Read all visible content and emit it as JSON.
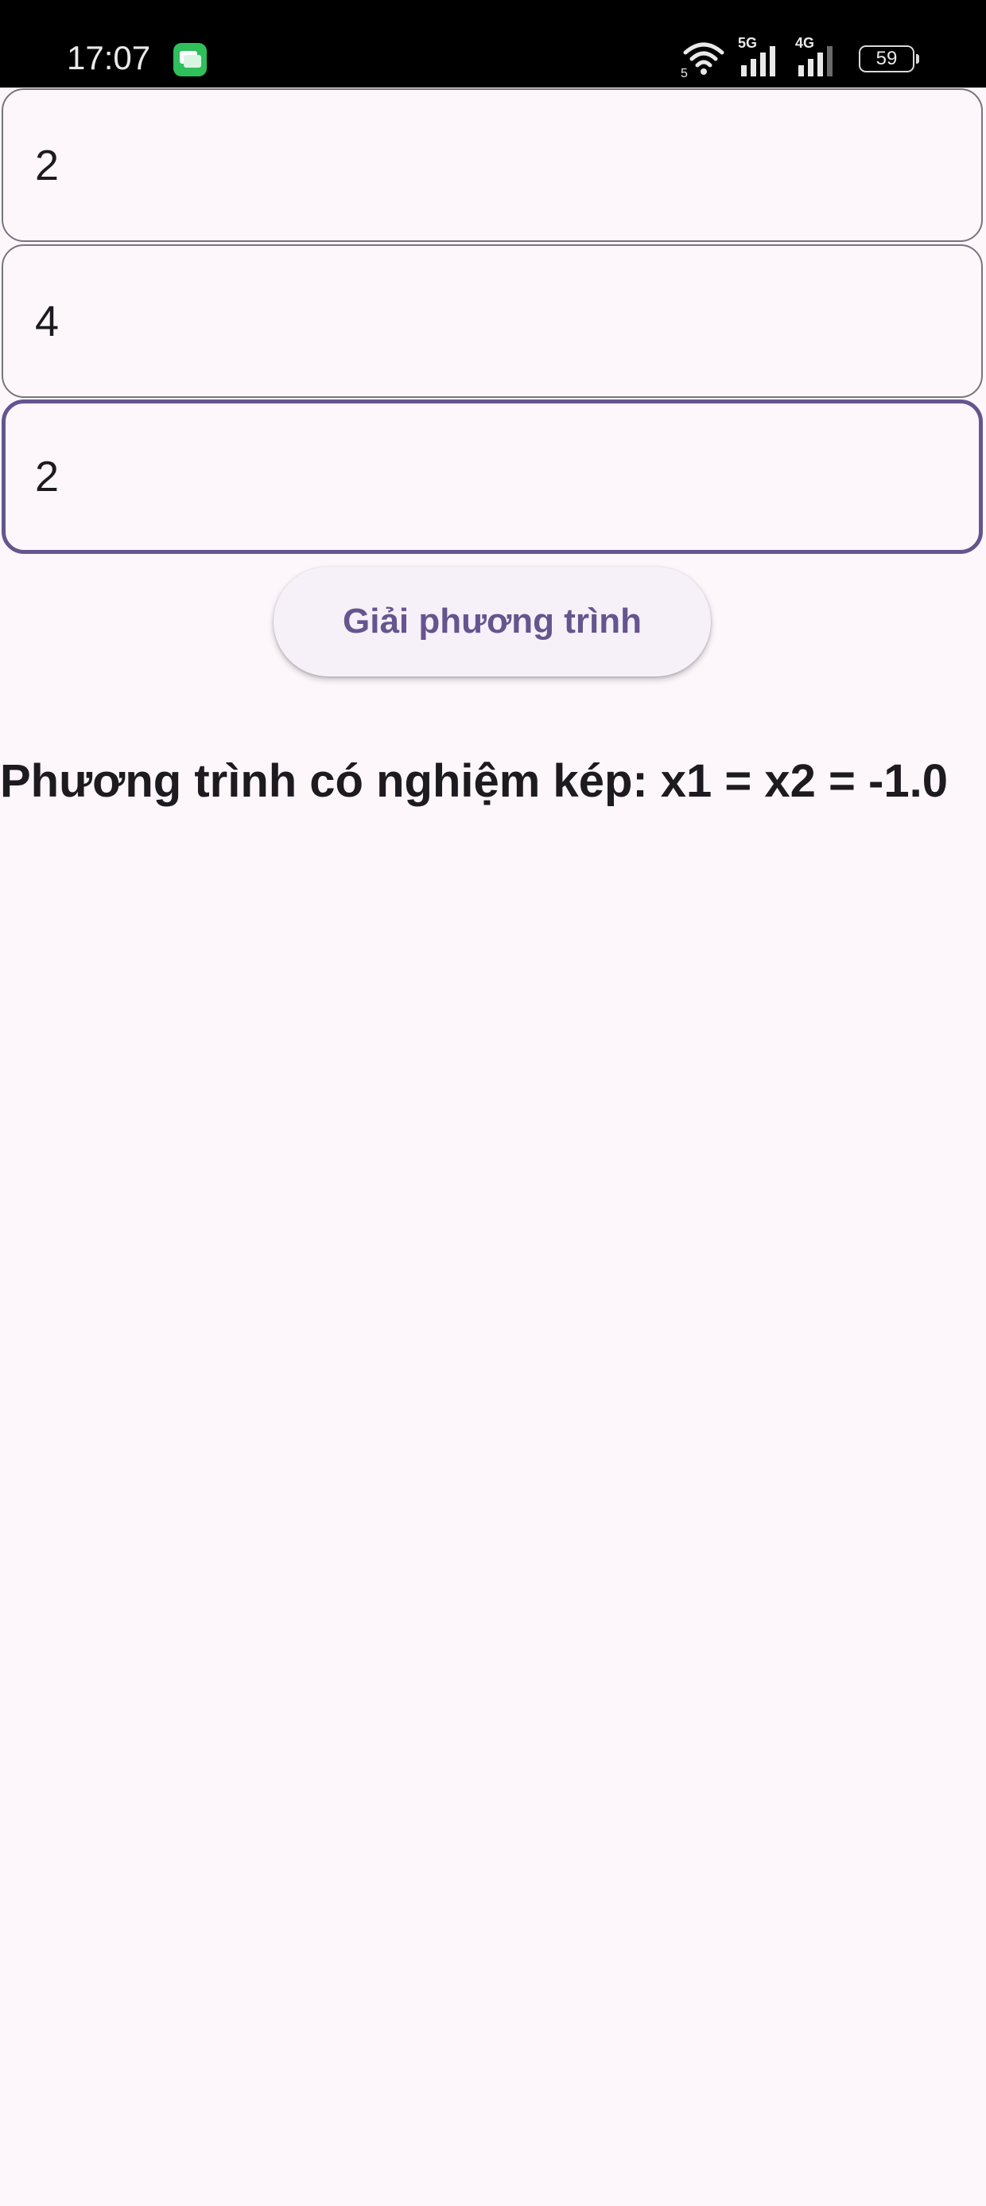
{
  "status_bar": {
    "time": "17:07",
    "wifi_sub": "5",
    "signal_1_label": "5G",
    "signal_2_label": "4G",
    "battery": "59"
  },
  "inputs": {
    "a": "2",
    "b": "4",
    "c": "2"
  },
  "solve_button": "Giải phương trình",
  "result": "Phương trình có nghiệm kép: x1 = x2 = -1.0",
  "colors": {
    "accent": "#65558f",
    "background": "#fdf7fc",
    "outline": "#79747e"
  }
}
